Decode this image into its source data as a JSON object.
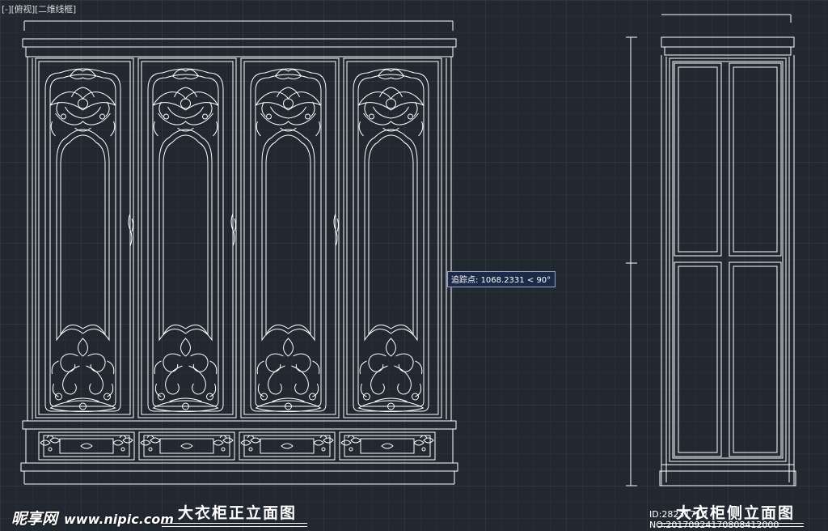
{
  "viewport": {
    "label": "[-][俯视][二维线框]"
  },
  "tracking_tooltip": {
    "label": "追踪点:",
    "value": "1068.2331",
    "angle": "< 90°"
  },
  "titles": {
    "front": "大衣柜正立面图",
    "side": "大衣柜侧立面图"
  },
  "watermark": {
    "brand": "昵享网",
    "site": "www.nipic.com",
    "image_id": "ID:28231710 NO:20170924170808412000"
  },
  "colors": {
    "background": "#212830",
    "grid": "#3a4048",
    "line": "#ffffff"
  },
  "drawing": {
    "front_elevation": {
      "door_count": 4,
      "drawer_count": 4
    },
    "side_elevation": {
      "panel_count": 4
    }
  }
}
